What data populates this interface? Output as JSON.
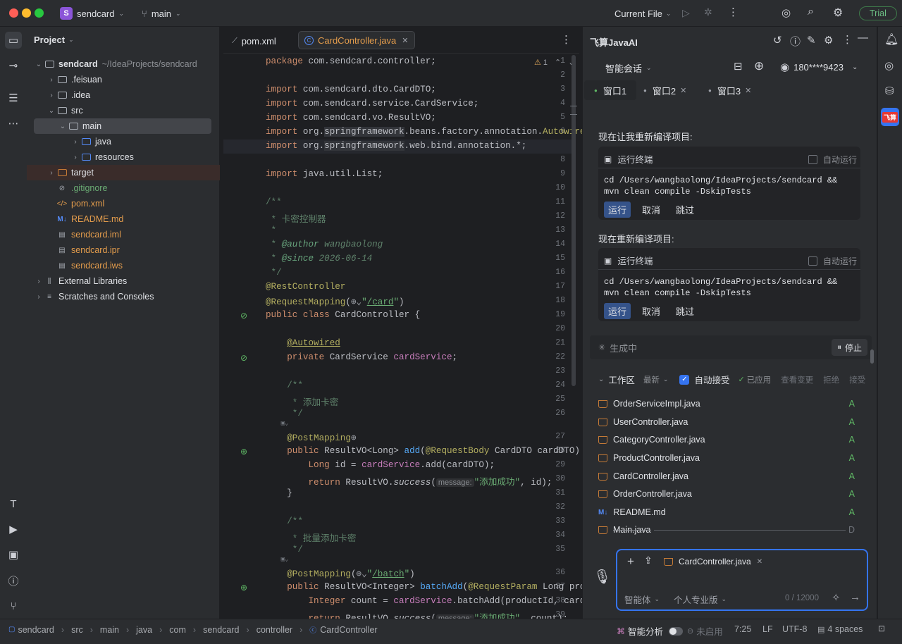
{
  "titlebar": {
    "project_letter": "S",
    "project_name": "sendcard",
    "branch": "main",
    "run_config": "Current File",
    "trial": "Trial"
  },
  "project_panel": {
    "title": "Project",
    "root_name": "sendcard",
    "root_path": "~/IdeaProjects/sendcard",
    "items": [
      {
        "label": ".feisuan"
      },
      {
        "label": ".idea"
      },
      {
        "label": "src"
      },
      {
        "label": "main"
      },
      {
        "label": "java"
      },
      {
        "label": "resources"
      },
      {
        "label": "target"
      },
      {
        "label": ".gitignore"
      },
      {
        "label": "pom.xml"
      },
      {
        "label": "README.md"
      },
      {
        "label": "sendcard.iml"
      },
      {
        "label": "sendcard.ipr"
      },
      {
        "label": "sendcard.iws"
      },
      {
        "label": "External Libraries"
      },
      {
        "label": "Scratches and Consoles"
      }
    ]
  },
  "editor": {
    "tabs": [
      {
        "label": "pom.xml"
      },
      {
        "label": "CardController.java"
      }
    ],
    "warning_count": "1",
    "param_hint": "message:"
  },
  "ai_panel": {
    "title": "飞算JavaAI",
    "mode": "智能会话",
    "user": "180****9423",
    "windows": [
      "窗口1",
      "窗口2",
      "窗口3"
    ],
    "blocks": [
      {
        "heading": "现在让我重新编译项目:",
        "terminal_label": "运行终端",
        "auto_run": "自动运行",
        "command_line1": "cd /Users/wangbaolong/IdeaProjects/sendcard &&",
        "command_line2": "mvn clean compile -DskipTests",
        "run": "运行",
        "cancel": "取消",
        "skip": "跳过"
      },
      {
        "heading": "现在重新编译项目:",
        "terminal_label": "运行终端",
        "auto_run": "自动运行",
        "command_line1": "cd /Users/wangbaolong/IdeaProjects/sendcard &&",
        "command_line2": "mvn clean compile -DskipTests",
        "run": "运行",
        "cancel": "取消",
        "skip": "跳过"
      }
    ],
    "generating": "生成中",
    "stop": "停止",
    "workspace": {
      "title": "工作区",
      "sort": "最新",
      "auto_accept": "自动接受",
      "applied": "已应用",
      "view_changes": "查看变更",
      "reject": "拒绝",
      "accept": "接受",
      "files": [
        {
          "name": "OrderServiceImpl.java",
          "status": "A"
        },
        {
          "name": "UserController.java",
          "status": "A"
        },
        {
          "name": "CategoryController.java",
          "status": "A"
        },
        {
          "name": "ProductController.java",
          "status": "A"
        },
        {
          "name": "CardController.java",
          "status": "A"
        },
        {
          "name": "OrderController.java",
          "status": "A"
        },
        {
          "name": "README.md",
          "status": "A"
        },
        {
          "name": "Main.java",
          "status": "D"
        }
      ]
    },
    "input": {
      "attachment": "CardController.java",
      "agent": "智能体",
      "edition": "个人专业版",
      "counter": "0 / 12000"
    }
  },
  "statusbar": {
    "breadcrumb": [
      "sendcard",
      "src",
      "main",
      "java",
      "com",
      "sendcard",
      "controller",
      "CardController"
    ],
    "smart_analysis": "智能分析",
    "disabled": "未启用",
    "position": "7:25",
    "line_sep": "LF",
    "encoding": "UTF-8",
    "indent": "4 spaces"
  }
}
